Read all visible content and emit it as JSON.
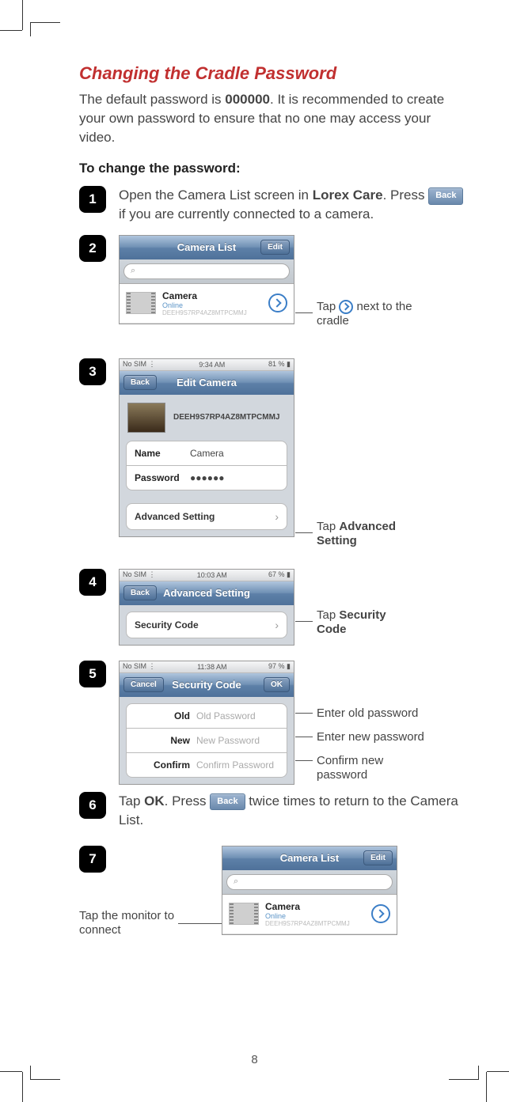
{
  "title": "Changing the Cradle Password",
  "intro_pre": "The default password is ",
  "intro_bold": "000000",
  "intro_post": ". It is recommended to create your own password to ensure that no one may access your video.",
  "subhead": "To change the password:",
  "step1": {
    "num": "1",
    "pre": "Open the Camera List screen in ",
    "bold": "Lorex Care",
    "mid": ". Press ",
    "back_label": "Back",
    "post": " if you are currently connected to a camera."
  },
  "step2": {
    "num": "2",
    "nav_title": "Camera List",
    "edit_label": "Edit",
    "search_icon": "⌕",
    "camera_name": "Camera",
    "camera_status": "Online",
    "camera_id": "DEEH9S7RP4AZ8MTPCMMJ",
    "annot_pre": "Tap ",
    "annot_post": " next to the cradle"
  },
  "step3": {
    "num": "3",
    "status_left": "No SIM",
    "status_time": "9:34 AM",
    "status_right": "81 %",
    "back_label": "Back",
    "nav_title": "Edit Camera",
    "device_id": "DEEH9S7RP4AZ8MTPCMMJ",
    "name_label": "Name",
    "name_value": "Camera",
    "pw_label": "Password",
    "pw_value": "●●●●●●",
    "adv_label": "Advanced Setting",
    "annot_pre": "Tap ",
    "annot_bold1": "Advanced",
    "annot_bold2": "Setting"
  },
  "step4": {
    "num": "4",
    "status_left": "No SIM",
    "status_time": "10:03 AM",
    "status_right": "67 %",
    "back_label": "Back",
    "nav_title": "Advanced Setting",
    "sec_label": "Security Code",
    "annot_pre": "Tap ",
    "annot_bold1": "Security",
    "annot_bold2": "Code"
  },
  "step5": {
    "num": "5",
    "status_left": "No SIM",
    "status_time": "11:38 AM",
    "status_right": "97 %",
    "cancel_label": "Cancel",
    "ok_label": "OK",
    "nav_title": "Security Code",
    "old_label": "Old",
    "old_ph": "Old Password",
    "new_label": "New",
    "new_ph": "New Password",
    "conf_label": "Confirm",
    "conf_ph": "Confirm Password",
    "annot_old": "Enter old password",
    "annot_new": "Enter new password",
    "annot_conf": "Confirm new password"
  },
  "step6": {
    "num": "6",
    "pre": "Tap ",
    "bold": "OK",
    "mid": ". Press ",
    "back_label": "Back",
    "post": " twice times to return to the Camera List."
  },
  "step7": {
    "num": "7",
    "nav_title": "Camera List",
    "edit_label": "Edit",
    "search_icon": "⌕",
    "camera_name": "Camera",
    "camera_status": "Online",
    "camera_id": "DEEH9S7RP4AZ8MTPCMMJ",
    "annot": "Tap the monitor to connect"
  },
  "page_number": "8"
}
